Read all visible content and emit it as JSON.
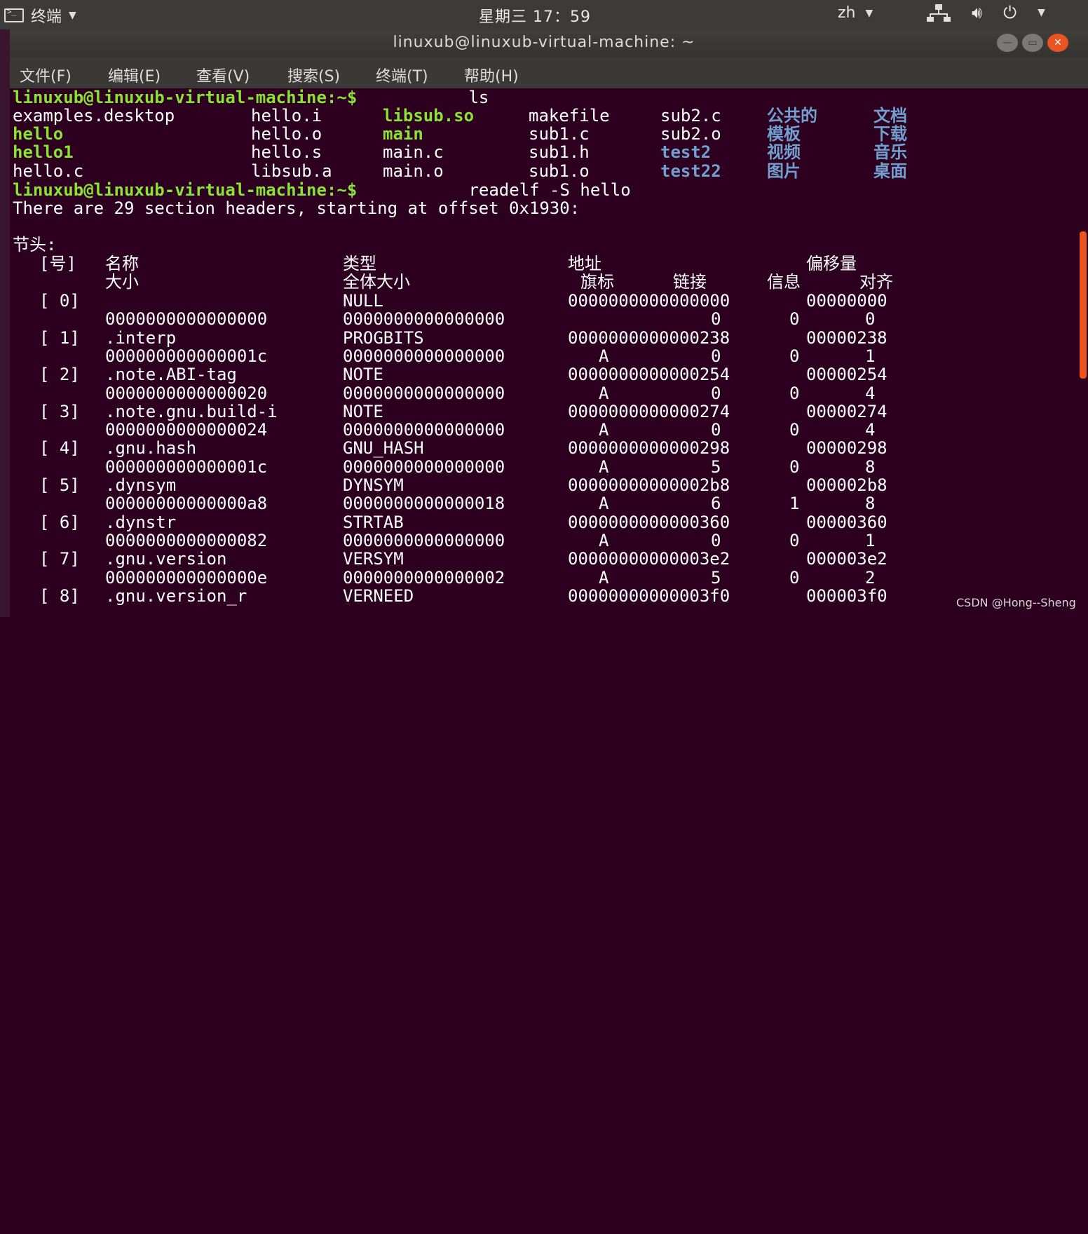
{
  "topbar": {
    "app_name": "终端",
    "clock": "星期三 17：59",
    "lang": "zh"
  },
  "window": {
    "title": "linuxub@linuxub-virtual-machine: ~"
  },
  "menu": [
    "文件(F)",
    "编辑(E)",
    "查看(V)",
    "搜索(S)",
    "终端(T)",
    "帮助(H)"
  ],
  "terminal": {
    "prompt1": "linuxub@linuxub-virtual-machine:~$",
    "cmd1": " ls",
    "ls": {
      "col1": [
        "examples.desktop",
        "hello",
        "hello1",
        "hello.c"
      ],
      "col2": [
        "hello.i",
        "hello.o",
        "hello.s",
        "libsub.a"
      ],
      "col3": [
        "libsub.so",
        "main",
        "main.c",
        "main.o"
      ],
      "col4": [
        "makefile",
        "sub1.c",
        "sub1.h",
        "sub1.o"
      ],
      "col5": [
        "sub2.c",
        "sub2.o",
        "test2",
        "test22"
      ],
      "col6": [
        "公共的",
        "模板",
        "视频",
        "图片"
      ],
      "col7": [
        "文档",
        "下载",
        "音乐",
        "桌面"
      ]
    },
    "prompt2": "linuxub@linuxub-virtual-machine:~$",
    "cmd2": " readelf -S hello",
    "summary": "There are 29 section headers, starting at offset 0x1930:",
    "headers_title": "节头:",
    "header": {
      "nr": "[号]",
      "name": "名称",
      "type": "类型",
      "addr": "地址",
      "offset": "偏移量",
      "size": "大小",
      "entsize": "全体大小",
      "flags": "旗标",
      "link": "链接",
      "info": "信息",
      "align": "对齐"
    },
    "sections": [
      {
        "nr": "[ 0]",
        "name": "",
        "type": "NULL",
        "addr": "0000000000000000",
        "offset": "00000000",
        "size": "0000000000000000",
        "entsize": "0000000000000000",
        "flags": "",
        "link": "0",
        "info": "0",
        "align": "0"
      },
      {
        "nr": "[ 1]",
        "name": ".interp",
        "type": "PROGBITS",
        "addr": "0000000000000238",
        "offset": "00000238",
        "size": "000000000000001c",
        "entsize": "0000000000000000",
        "flags": "A",
        "link": "0",
        "info": "0",
        "align": "1"
      },
      {
        "nr": "[ 2]",
        "name": ".note.ABI-tag",
        "type": "NOTE",
        "addr": "0000000000000254",
        "offset": "00000254",
        "size": "0000000000000020",
        "entsize": "0000000000000000",
        "flags": "A",
        "link": "0",
        "info": "0",
        "align": "4"
      },
      {
        "nr": "[ 3]",
        "name": ".note.gnu.build-i",
        "type": "NOTE",
        "addr": "0000000000000274",
        "offset": "00000274",
        "size": "0000000000000024",
        "entsize": "0000000000000000",
        "flags": "A",
        "link": "0",
        "info": "0",
        "align": "4"
      },
      {
        "nr": "[ 4]",
        "name": ".gnu.hash",
        "type": "GNU_HASH",
        "addr": "0000000000000298",
        "offset": "00000298",
        "size": "000000000000001c",
        "entsize": "0000000000000000",
        "flags": "A",
        "link": "5",
        "info": "0",
        "align": "8"
      },
      {
        "nr": "[ 5]",
        "name": ".dynsym",
        "type": "DYNSYM",
        "addr": "00000000000002b8",
        "offset": "000002b8",
        "size": "00000000000000a8",
        "entsize": "0000000000000018",
        "flags": "A",
        "link": "6",
        "info": "1",
        "align": "8"
      },
      {
        "nr": "[ 6]",
        "name": ".dynstr",
        "type": "STRTAB",
        "addr": "0000000000000360",
        "offset": "00000360",
        "size": "0000000000000082",
        "entsize": "0000000000000000",
        "flags": "A",
        "link": "0",
        "info": "0",
        "align": "1"
      },
      {
        "nr": "[ 7]",
        "name": ".gnu.version",
        "type": "VERSYM",
        "addr": "00000000000003e2",
        "offset": "000003e2",
        "size": "000000000000000e",
        "entsize": "0000000000000002",
        "flags": "A",
        "link": "5",
        "info": "0",
        "align": "2"
      },
      {
        "nr": "[ 8]",
        "name": ".gnu.version_r",
        "type": "VERNEED",
        "addr": "00000000000003f0",
        "offset": "000003f0",
        "size": "",
        "entsize": "",
        "flags": "",
        "link": "",
        "info": "",
        "align": ""
      }
    ]
  },
  "watermark": "CSDN @Hong--Sheng"
}
